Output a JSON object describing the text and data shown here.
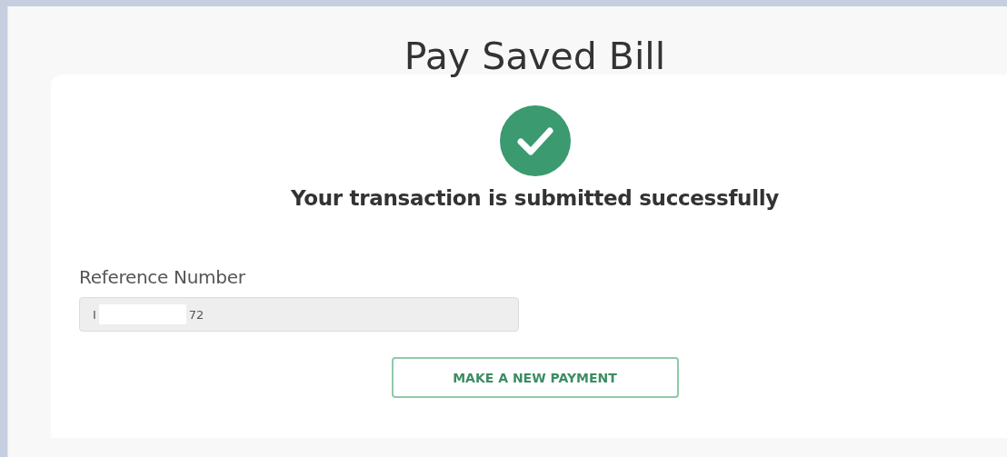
{
  "page": {
    "title": "Pay Saved Bill"
  },
  "confirmation": {
    "message": "Your transaction is submitted successfully"
  },
  "reference": {
    "label": "Reference Number",
    "value_parts": [
      "I",
      "72"
    ]
  },
  "buttons": [
    {
      "label": "MAKE A NEW PAYMENT"
    }
  ]
}
